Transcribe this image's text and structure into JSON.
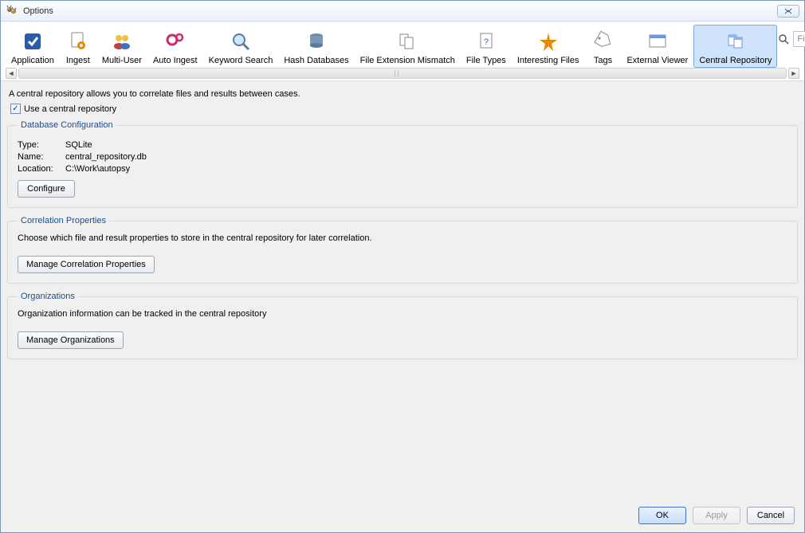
{
  "window": {
    "title": "Options"
  },
  "search": {
    "placeholder": "Filter (Ctrl+F)"
  },
  "toolbar": [
    {
      "label": "Application",
      "icon": "checkmark-square-icon",
      "selected": false
    },
    {
      "label": "Ingest",
      "icon": "page-gear-icon",
      "selected": false
    },
    {
      "label": "Multi-User",
      "icon": "users-icon",
      "selected": false
    },
    {
      "label": "Auto Ingest",
      "icon": "gears-icon",
      "selected": false
    },
    {
      "label": "Keyword Search",
      "icon": "magnifier-icon",
      "selected": false
    },
    {
      "label": "Hash Databases",
      "icon": "database-icon",
      "selected": false
    },
    {
      "label": "File Extension Mismatch",
      "icon": "files-icon",
      "selected": false
    },
    {
      "label": "File Types",
      "icon": "file-question-icon",
      "selected": false
    },
    {
      "label": "Interesting Files",
      "icon": "star-icon",
      "selected": false
    },
    {
      "label": "Tags",
      "icon": "tag-icon",
      "selected": false
    },
    {
      "label": "External Viewer",
      "icon": "window-icon",
      "selected": false
    },
    {
      "label": "Central Repository",
      "icon": "files-stack-icon",
      "selected": true
    }
  ],
  "intro": "A central repository allows you to correlate files and results between cases.",
  "use_checkbox": {
    "checked": true,
    "label": "Use a central repository"
  },
  "db": {
    "legend": "Database Configuration",
    "rows": {
      "type_k": "Type:",
      "type_v": "SQLite",
      "name_k": "Name:",
      "name_v": "central_repository.db",
      "loc_k": "Location:",
      "loc_v": "C:\\Work\\autopsy"
    },
    "configure_btn": "Configure"
  },
  "corr": {
    "legend": "Correlation Properties",
    "desc": "Choose which file and result properties to store in the central repository for later correlation.",
    "btn": "Manage Correlation Properties"
  },
  "orgs": {
    "legend": "Organizations",
    "desc": "Organization information can be tracked in the central repository",
    "btn": "Manage Organizations"
  },
  "footer": {
    "ok": "OK",
    "apply": "Apply",
    "cancel": "Cancel"
  }
}
